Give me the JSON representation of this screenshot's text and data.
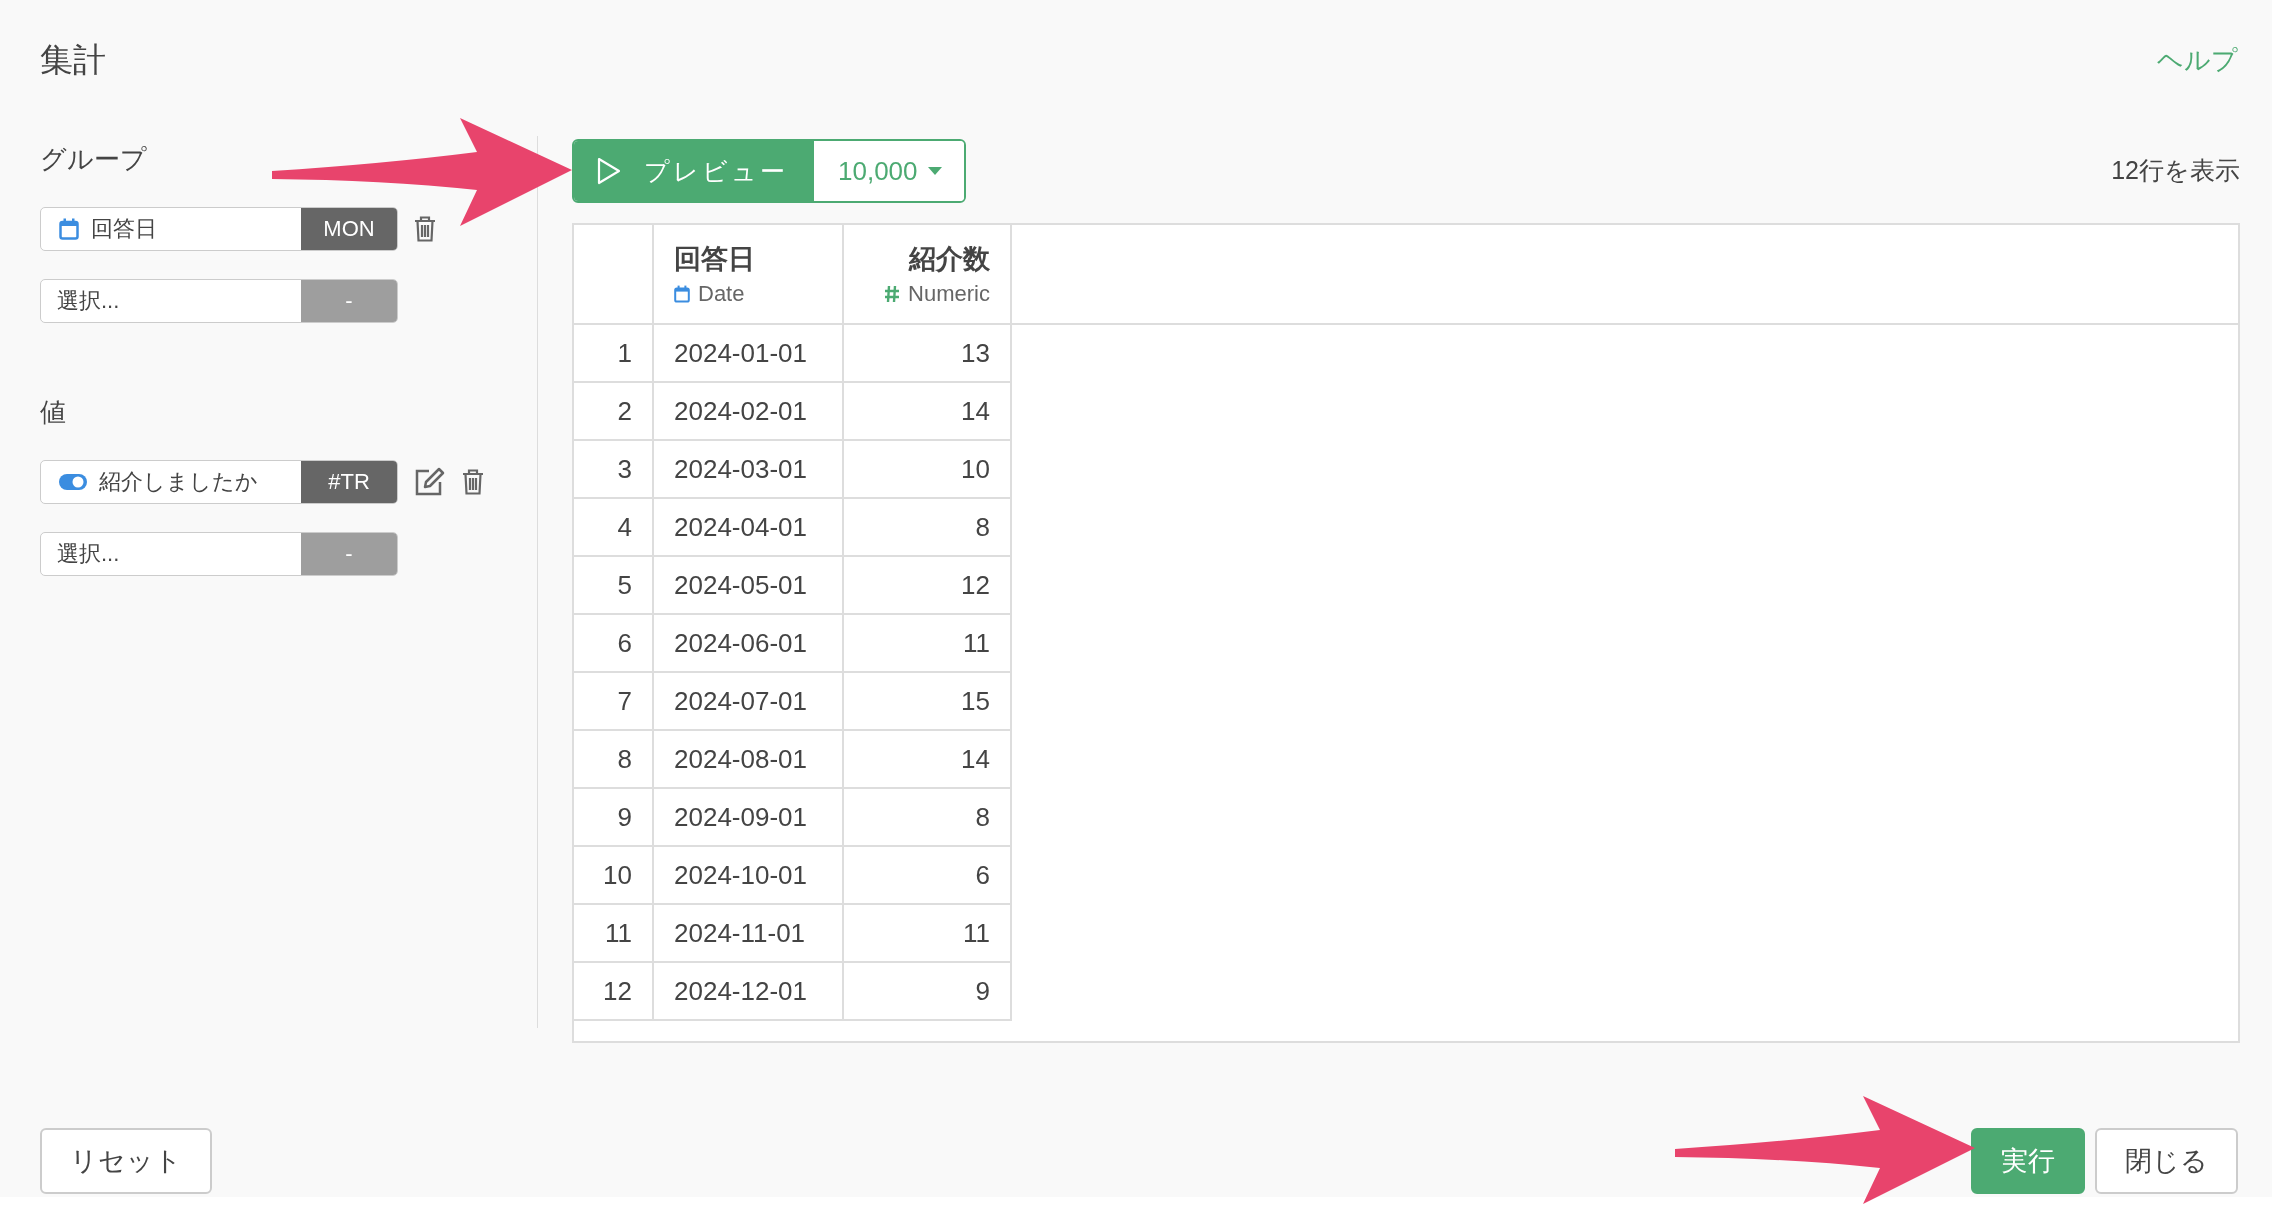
{
  "title": "集計",
  "help_link": "ヘルプ",
  "sections": [
    {
      "label": "グループ",
      "fields": [
        {
          "kind": "date",
          "name": "回答日",
          "tag": "MON",
          "editable": false,
          "removable": true
        },
        {
          "kind": "empty",
          "placeholder": "選択...",
          "tag": "-",
          "editable": false,
          "removable": false
        }
      ]
    },
    {
      "label": "値",
      "fields": [
        {
          "kind": "boolean",
          "name": "紹介しましたか",
          "tag": "#TR",
          "editable": true,
          "removable": true
        },
        {
          "kind": "empty",
          "placeholder": "選択...",
          "tag": "-",
          "editable": false,
          "removable": false
        }
      ]
    }
  ],
  "preview": {
    "button": "プレビュー",
    "limit": "10,000",
    "row_count": "12行を表示"
  },
  "table": {
    "columns": [
      {
        "name": "回答日",
        "type": "Date",
        "kind": "date"
      },
      {
        "name": "紹介数",
        "type": "Numeric",
        "kind": "numeric"
      }
    ],
    "rows": [
      {
        "index": "1",
        "cells": [
          "2024-01-01",
          "13"
        ]
      },
      {
        "index": "2",
        "cells": [
          "2024-02-01",
          "14"
        ]
      },
      {
        "index": "3",
        "cells": [
          "2024-03-01",
          "10"
        ]
      },
      {
        "index": "4",
        "cells": [
          "2024-04-01",
          "8"
        ]
      },
      {
        "index": "5",
        "cells": [
          "2024-05-01",
          "12"
        ]
      },
      {
        "index": "6",
        "cells": [
          "2024-06-01",
          "11"
        ]
      },
      {
        "index": "7",
        "cells": [
          "2024-07-01",
          "15"
        ]
      },
      {
        "index": "8",
        "cells": [
          "2024-08-01",
          "14"
        ]
      },
      {
        "index": "9",
        "cells": [
          "2024-09-01",
          "8"
        ]
      },
      {
        "index": "10",
        "cells": [
          "2024-10-01",
          "6"
        ]
      },
      {
        "index": "11",
        "cells": [
          "2024-11-01",
          "11"
        ]
      },
      {
        "index": "12",
        "cells": [
          "2024-12-01",
          "9"
        ]
      }
    ]
  },
  "footer": {
    "reset": "リセット",
    "run": "実行",
    "close": "閉じる"
  }
}
